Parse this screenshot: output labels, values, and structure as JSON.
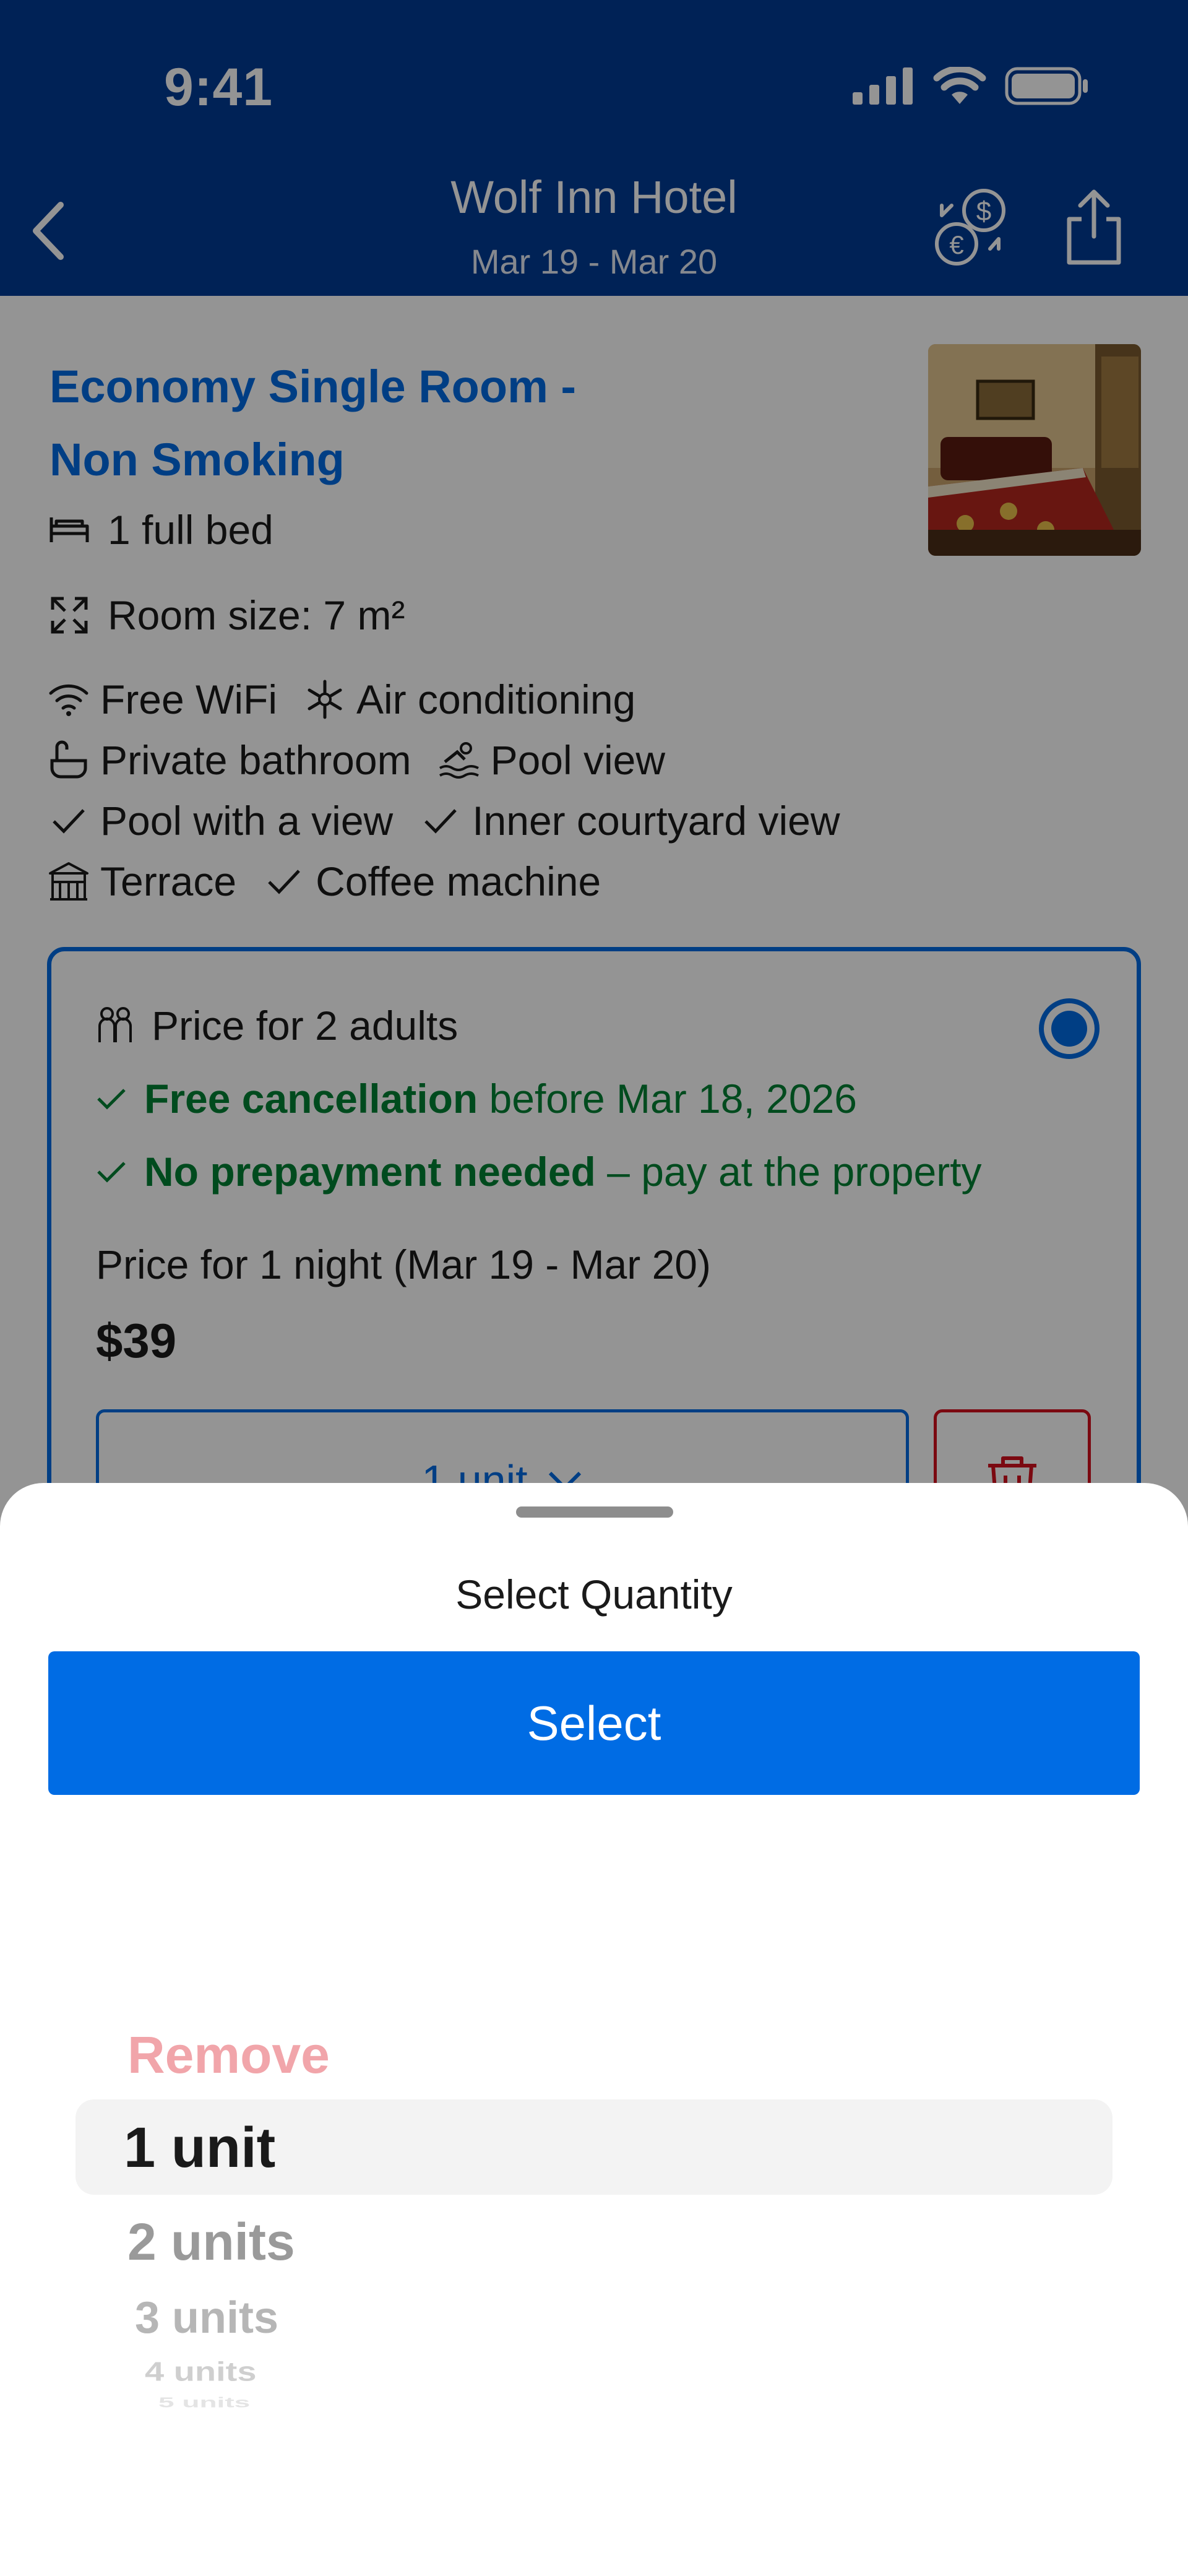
{
  "status_bar": {
    "time": "9:41"
  },
  "header": {
    "title": "Wolf Inn Hotel",
    "dates": "Mar 19 - Mar 20",
    "icons": [
      "chevron-left-icon",
      "currency-exchange-icon",
      "share-icon"
    ]
  },
  "room": {
    "name_line1": "Economy Single Room -",
    "name_line2": "Non Smoking",
    "bed": "1 full bed",
    "size": "Room size: 7 m²",
    "facilities": [
      [
        "Free WiFi",
        "Air conditioning"
      ],
      [
        "Private bathroom",
        "Pool view"
      ],
      [
        "Pool with a view",
        "Inner courtyard view"
      ],
      [
        "Terrace",
        "Coffee machine"
      ]
    ]
  },
  "option": {
    "occupancy": "Price for 2 adults",
    "cancel_bold": "Free cancellation",
    "cancel_rest": " before Mar 18, 2026",
    "prepay_bold": "No prepayment needed",
    "prepay_rest": " – pay at the property",
    "price_note": "Price for 1 night (Mar 19 - Mar 20)",
    "price": "$39",
    "units_label": "1 unit",
    "selected": true
  },
  "sheet": {
    "title": "Select Quantity",
    "select_label": "Select",
    "picker": {
      "remove": "Remove",
      "selected": "1 unit",
      "options": [
        "2 units",
        "3 units",
        "4 units",
        "5 units"
      ]
    }
  },
  "colors": {
    "header_bg": "#003b95",
    "accent": "#006ce4",
    "success": "#008234",
    "danger": "#d4111e"
  }
}
